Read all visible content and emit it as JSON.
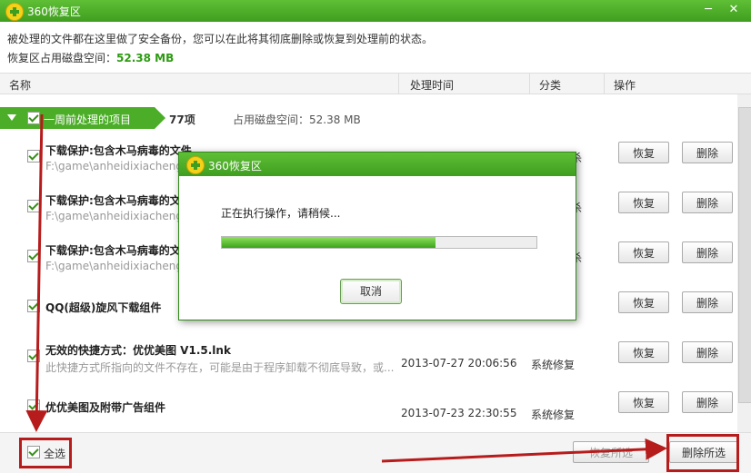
{
  "window": {
    "title": "360恢复区",
    "controls": [
      "─",
      "✕"
    ]
  },
  "notice": "被处理的文件都在这里做了安全备份，您可以在此将其彻底删除或恢复到处理前的状态。",
  "space": {
    "label": "恢复区占用磁盘空间：",
    "value": "52.38 MB"
  },
  "columns": {
    "name": "名称",
    "time": "处理时间",
    "category": "分类",
    "action": "操作"
  },
  "group": {
    "label": "一周前处理的项目",
    "count": "77项",
    "space": "占用磁盘空间：52.38 MB",
    "checked": true
  },
  "rows": [
    {
      "name": "下载保护:包含木马病毒的文件",
      "sub": "F:\\game\\anheidixiachengy",
      "time": "",
      "category": "杀",
      "restore": "恢复",
      "delete": "删除"
    },
    {
      "name": "下载保护:包含木马病毒的文",
      "sub": "F:\\game\\anheidixiachengy",
      "time": "",
      "category": "杀",
      "restore": "恢复",
      "delete": "删除"
    },
    {
      "name": "下载保护:包含木马病毒的文",
      "sub": "F:\\game\\anheidixiachengy",
      "time": "",
      "category": "杀",
      "restore": "恢复",
      "delete": "删除"
    },
    {
      "name": "QQ(超级)旋风下载组件",
      "sub": "",
      "time": "",
      "category": "",
      "restore": "恢复",
      "delete": "删除"
    },
    {
      "name": "无效的快捷方式：优优美图 V1.5.lnk",
      "sub": "此快捷方式所指向的文件不存在，可能是由于程序卸载不彻底导致，或...",
      "time": "2013-07-27 20:06:56",
      "category": "系统修复",
      "restore": "恢复",
      "delete": "删除"
    },
    {
      "name": "优优美图及附带广告组件",
      "sub": "",
      "time": "2013-07-23 22:30:55",
      "category": "系统修复",
      "restore": "恢复",
      "delete": "删除"
    }
  ],
  "footer": {
    "select_all": "全选",
    "restore_selected": "恢复所选",
    "delete_selected": "删除所选"
  },
  "dialog": {
    "title": "360恢复区",
    "message": "正在执行操作，请稍候...",
    "progress": 0.68,
    "cancel": "取消"
  },
  "accent": "#3f9e1f",
  "annotation_color": "#b71c1c"
}
